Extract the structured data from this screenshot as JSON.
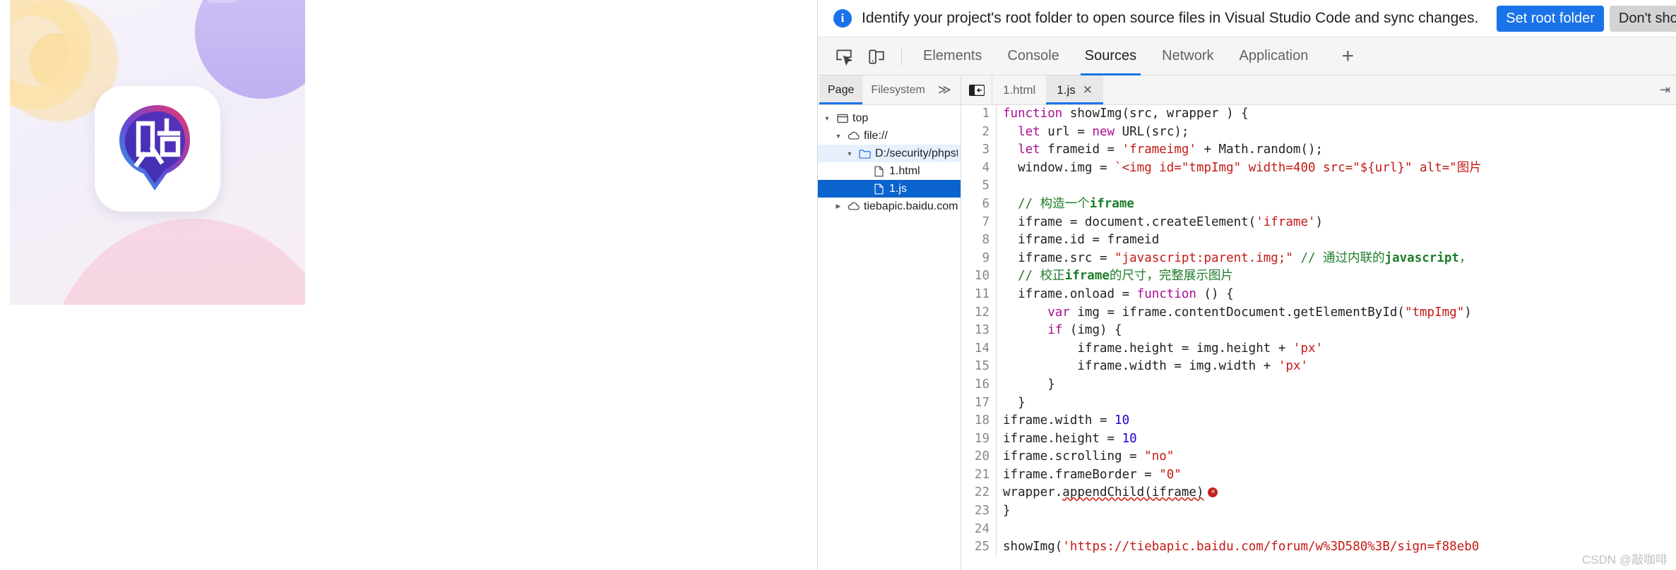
{
  "artwork": {
    "name": "tieba-app-icon-artwork",
    "glyph": "贴",
    "alt": "Baidu Tieba app icon on pastel gradient background"
  },
  "banner": {
    "icon": "info-icon",
    "message": "Identify your project's root folder to open source files in Visual Studio Code and sync changes.",
    "primary_label": "Set root folder",
    "secondary_label": "Don't show again"
  },
  "toolbar": {
    "inspect_icon": "inspect-element-icon",
    "device_icon": "device-toolbar-icon",
    "tabs": [
      {
        "label": "Elements",
        "active": false
      },
      {
        "label": "Console",
        "active": false
      },
      {
        "label": "Sources",
        "active": true
      },
      {
        "label": "Network",
        "active": false
      },
      {
        "label": "Application",
        "active": false
      }
    ],
    "more_tabs_label": "+"
  },
  "navigator": {
    "tabs": [
      {
        "label": "Page",
        "active": true
      },
      {
        "label": "Filesystem",
        "active": false
      }
    ],
    "overflow_label": "≫",
    "menu_label": "⋯",
    "tree": [
      {
        "label": "top",
        "icon": "frame-icon",
        "twisty": "down",
        "indent": 0,
        "state": "normal"
      },
      {
        "label": "file://",
        "icon": "cloud-icon",
        "twisty": "down",
        "indent": 1,
        "state": "normal"
      },
      {
        "label": "D:/security/phpstudy_pro/WWW",
        "icon": "folder-icon",
        "twisty": "down",
        "indent": 2,
        "state": "highlight"
      },
      {
        "label": "1.html",
        "icon": "file-icon",
        "twisty": "none",
        "indent": 3,
        "state": "normal"
      },
      {
        "label": "1.js",
        "icon": "file-icon",
        "twisty": "none",
        "indent": 3,
        "state": "selected"
      },
      {
        "label": "tiebapic.baidu.com",
        "icon": "cloud-icon",
        "twisty": "right",
        "indent": 1,
        "state": "normal"
      }
    ]
  },
  "editor": {
    "dock_icon": "show-navigator-icon",
    "tabs": [
      {
        "label": "1.html",
        "active": false,
        "closable": false
      },
      {
        "label": "1.js",
        "active": true,
        "closable": true
      }
    ],
    "close_glyph": "✕",
    "filename": "1.js",
    "lines": [
      {
        "n": 1,
        "tokens": [
          {
            "t": "function",
            "c": "kw"
          },
          {
            "t": " showImg(src, wrapper ) {",
            "c": "plain"
          }
        ]
      },
      {
        "n": 2,
        "tokens": [
          {
            "t": "  ",
            "c": "plain"
          },
          {
            "t": "let",
            "c": "kw"
          },
          {
            "t": " url = ",
            "c": "plain"
          },
          {
            "t": "new",
            "c": "kw"
          },
          {
            "t": " URL(src);",
            "c": "plain"
          }
        ]
      },
      {
        "n": 3,
        "tokens": [
          {
            "t": "  ",
            "c": "plain"
          },
          {
            "t": "let",
            "c": "kw"
          },
          {
            "t": " frameid = ",
            "c": "plain"
          },
          {
            "t": "'frameimg'",
            "c": "str"
          },
          {
            "t": " + Math.random();",
            "c": "plain"
          }
        ]
      },
      {
        "n": 4,
        "tokens": [
          {
            "t": "  window.img = ",
            "c": "plain"
          },
          {
            "t": "`<img id=\"tmpImg\" width=400 src=\"${url}\" alt=\"图片",
            "c": "str"
          }
        ]
      },
      {
        "n": 5,
        "tokens": [
          {
            "t": "",
            "c": "plain"
          }
        ]
      },
      {
        "n": 6,
        "tokens": [
          {
            "t": "  ",
            "c": "plain"
          },
          {
            "t": "// 构造一个",
            "c": "com"
          },
          {
            "t": "iframe",
            "c": "comb"
          }
        ]
      },
      {
        "n": 7,
        "tokens": [
          {
            "t": "  iframe = document.createElement(",
            "c": "plain"
          },
          {
            "t": "'iframe'",
            "c": "str"
          },
          {
            "t": ")",
            "c": "plain"
          }
        ]
      },
      {
        "n": 8,
        "tokens": [
          {
            "t": "  iframe.id = frameid",
            "c": "plain"
          }
        ]
      },
      {
        "n": 9,
        "tokens": [
          {
            "t": "  iframe.src = ",
            "c": "plain"
          },
          {
            "t": "\"javascript:parent.img;\"",
            "c": "str"
          },
          {
            "t": " ",
            "c": "plain"
          },
          {
            "t": "// 通过内联的",
            "c": "com"
          },
          {
            "t": "javascript",
            "c": "comb"
          },
          {
            "t": "，",
            "c": "com"
          }
        ]
      },
      {
        "n": 10,
        "tokens": [
          {
            "t": "  ",
            "c": "plain"
          },
          {
            "t": "// 校正",
            "c": "com"
          },
          {
            "t": "iframe",
            "c": "comb"
          },
          {
            "t": "的尺寸，完整展示图片",
            "c": "com"
          }
        ]
      },
      {
        "n": 11,
        "tokens": [
          {
            "t": "  iframe.onload = ",
            "c": "plain"
          },
          {
            "t": "function",
            "c": "kw"
          },
          {
            "t": " () {",
            "c": "plain"
          }
        ]
      },
      {
        "n": 12,
        "tokens": [
          {
            "t": "      ",
            "c": "plain"
          },
          {
            "t": "var",
            "c": "kw"
          },
          {
            "t": " img = iframe.contentDocument.getElementById(",
            "c": "plain"
          },
          {
            "t": "\"tmpImg\"",
            "c": "str"
          },
          {
            "t": ")",
            "c": "plain"
          }
        ]
      },
      {
        "n": 13,
        "tokens": [
          {
            "t": "      ",
            "c": "plain"
          },
          {
            "t": "if",
            "c": "kw"
          },
          {
            "t": " (img) {",
            "c": "plain"
          }
        ]
      },
      {
        "n": 14,
        "tokens": [
          {
            "t": "          iframe.height = img.height + ",
            "c": "plain"
          },
          {
            "t": "'px'",
            "c": "str"
          }
        ]
      },
      {
        "n": 15,
        "tokens": [
          {
            "t": "          iframe.width = img.width + ",
            "c": "plain"
          },
          {
            "t": "'px'",
            "c": "str"
          }
        ]
      },
      {
        "n": 16,
        "tokens": [
          {
            "t": "      }",
            "c": "plain"
          }
        ]
      },
      {
        "n": 17,
        "tokens": [
          {
            "t": "  }",
            "c": "plain"
          }
        ]
      },
      {
        "n": 18,
        "tokens": [
          {
            "t": "iframe.width = ",
            "c": "plain"
          },
          {
            "t": "10",
            "c": "num"
          }
        ]
      },
      {
        "n": 19,
        "tokens": [
          {
            "t": "iframe.height = ",
            "c": "plain"
          },
          {
            "t": "10",
            "c": "num"
          }
        ]
      },
      {
        "n": 20,
        "tokens": [
          {
            "t": "iframe.scrolling = ",
            "c": "plain"
          },
          {
            "t": "\"no\"",
            "c": "str"
          }
        ]
      },
      {
        "n": 21,
        "tokens": [
          {
            "t": "iframe.frameBorder = ",
            "c": "plain"
          },
          {
            "t": "\"0\"",
            "c": "str"
          }
        ]
      },
      {
        "n": 22,
        "tokens": [
          {
            "t": "wrapper.",
            "c": "plain"
          },
          {
            "t": "appendChild(iframe)",
            "c": "plain",
            "squiggle": true
          }
        ],
        "error": true
      },
      {
        "n": 23,
        "tokens": [
          {
            "t": "}",
            "c": "plain"
          }
        ]
      },
      {
        "n": 24,
        "tokens": [
          {
            "t": "",
            "c": "plain"
          }
        ]
      },
      {
        "n": 25,
        "tokens": [
          {
            "t": "showImg(",
            "c": "plain"
          },
          {
            "t": "'https://tiebapic.baidu.com/forum/w%3D580%3B/sign=f88eb0",
            "c": "str"
          }
        ]
      }
    ],
    "error_glyph": "×"
  },
  "watermark": {
    "text": "CSDN @敲咖啡"
  },
  "colors": {
    "accent": "#1a73e8",
    "selection": "#0b63ce",
    "highlight": "#e8f0fe",
    "error": "#c5221f",
    "string": "#c41a16",
    "keyword": "#aa0d91",
    "comment": "#1d7d29",
    "number": "#1c00cf"
  }
}
